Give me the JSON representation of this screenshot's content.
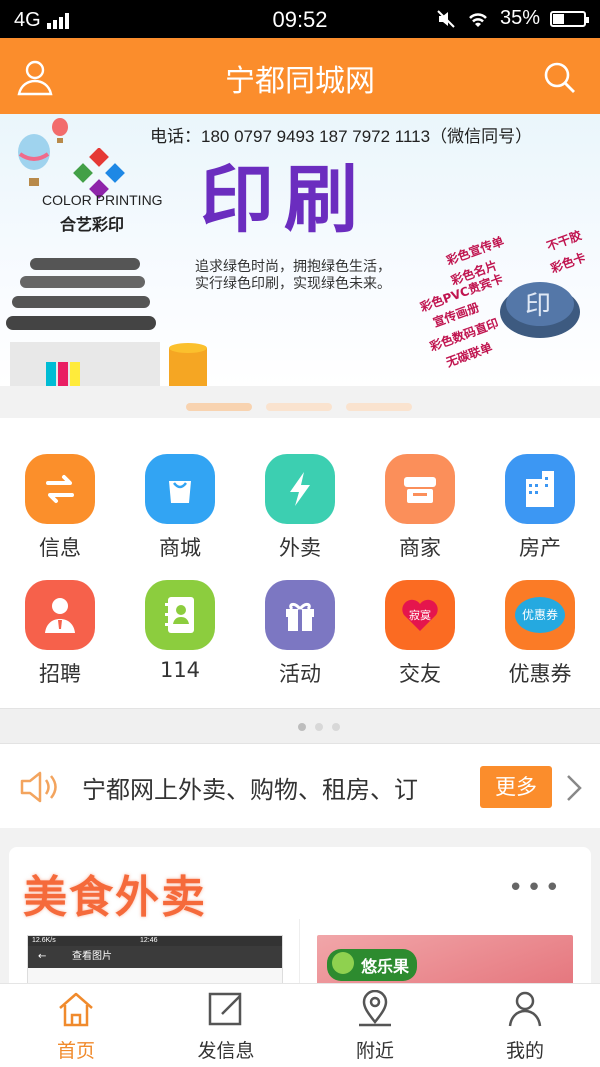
{
  "status_bar": {
    "network": "4G",
    "time": "09:52",
    "battery": "35%"
  },
  "header": {
    "title": "宁都同城网"
  },
  "banner": {
    "phone_text": "电话：180 0797 9493  187 7972 1113（微信同号）",
    "logo_en": "COLOR PRINTING",
    "logo_cn": "合艺彩印",
    "headline": "印刷",
    "slogan_1": "追求绿色时尚，拥抱绿色生活，",
    "slogan_2": "实行绿色印刷，实现绿色未来。",
    "tags": [
      "彩色宣传单",
      "彩色名片",
      "彩色PVC贵宾卡",
      "宣传画册",
      "彩色数码直印",
      "无碳联单",
      "不干胶",
      "彩色卡"
    ]
  },
  "categories": [
    {
      "label": "信息",
      "icon": "swap-arrows-icon",
      "color": "#fb8f2b"
    },
    {
      "label": "商城",
      "icon": "shopping-bag-icon",
      "color": "#32a4f3"
    },
    {
      "label": "外卖",
      "icon": "lightning-icon",
      "color": "#3ccfb1"
    },
    {
      "label": "商家",
      "icon": "storefront-icon",
      "color": "#fb8f5a"
    },
    {
      "label": "房产",
      "icon": "building-icon",
      "color": "#3c97f3"
    },
    {
      "label": "招聘",
      "icon": "businessman-icon",
      "color": "#f6614b"
    },
    {
      "label": "114",
      "icon": "contacts-book-icon",
      "color": "#8ccd3e"
    },
    {
      "label": "活动",
      "icon": "gift-icon",
      "color": "#7c77c2"
    },
    {
      "label": "交友",
      "icon": "heart-icon",
      "color": "#fb6b22",
      "badge": "寂寞"
    },
    {
      "label": "优惠券",
      "icon": "coupon-icon",
      "color": "#fb7b26",
      "badge": "优惠券"
    }
  ],
  "notice": {
    "text": "宁都网上外卖、购物、租房、订",
    "more_label": "更多"
  },
  "food": {
    "title": "美食外卖",
    "thumb1_status": "12.6K/s",
    "thumb1_time": "12:46",
    "thumb1_caption": "查看图片",
    "thumb2_brand": "悠乐果"
  },
  "tabbar": [
    {
      "label": "首页",
      "icon": "home-icon",
      "active": true
    },
    {
      "label": "发信息",
      "icon": "edit-icon",
      "active": false
    },
    {
      "label": "附近",
      "icon": "location-pin-icon",
      "active": false
    },
    {
      "label": "我的",
      "icon": "person-icon",
      "active": false
    }
  ],
  "colors": {
    "brand_orange": "#fb8d2c",
    "active_tab": "#f08a2c"
  }
}
